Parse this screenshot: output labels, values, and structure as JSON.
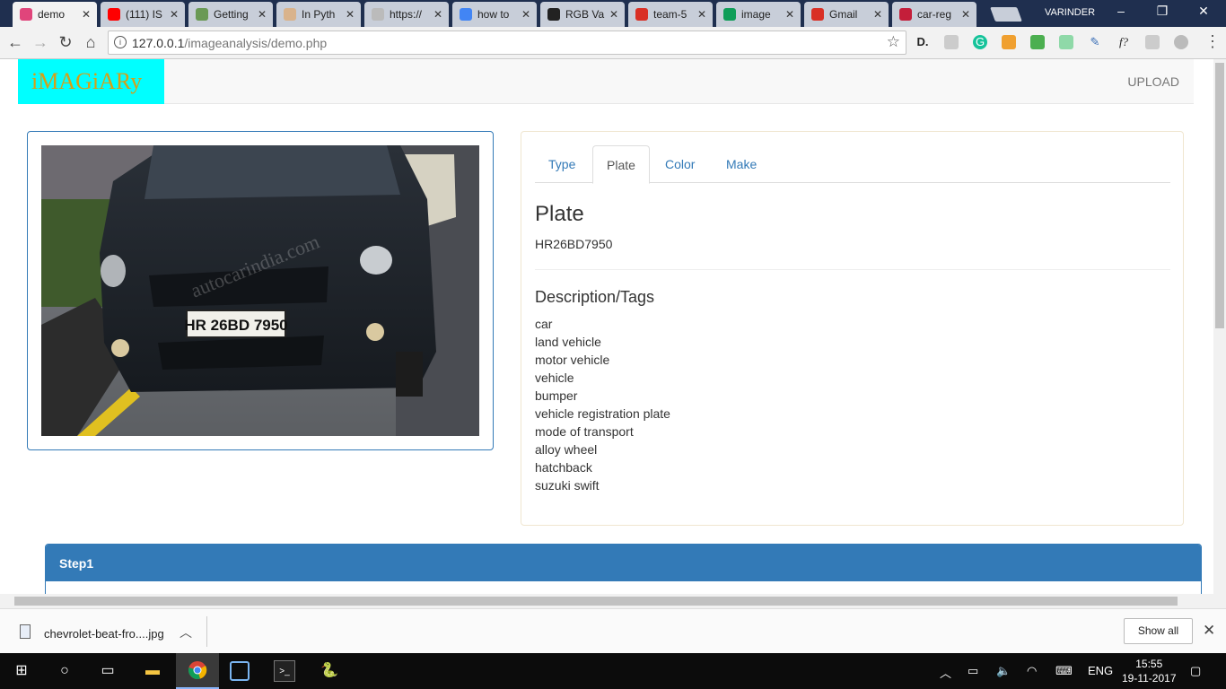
{
  "browser": {
    "tabs": [
      {
        "title": "demo",
        "color": "#e0457b",
        "active": true
      },
      {
        "title": "(111) IS",
        "color": "#ff0000"
      },
      {
        "title": "Getting",
        "color": "#6a9955"
      },
      {
        "title": "In Pyth",
        "color": "#d9b38c"
      },
      {
        "title": "https://",
        "color": "#bbbbbb"
      },
      {
        "title": "how to",
        "color": "#4285f4"
      },
      {
        "title": "RGB Va",
        "color": "#222222"
      },
      {
        "title": "team-5",
        "color": "#d93025"
      },
      {
        "title": "image",
        "color": "#0f9d58"
      },
      {
        "title": "Gmail",
        "color": "#d93025"
      },
      {
        "title": "car-reg",
        "color": "#c41e3a"
      }
    ],
    "user": "VARINDER",
    "url_host": "127.0.0.1",
    "url_path": "/imageanalysis/demo.php"
  },
  "page": {
    "brand": "iMAGiARy",
    "upload_label": "UPLOAD",
    "photo_watermark": "autocarindia.com",
    "photo_plate_text": "HR 26BD 7950",
    "result_tabs": [
      "Type",
      "Plate",
      "Color",
      "Make"
    ],
    "active_tab": "Plate",
    "plate_heading": "Plate",
    "plate_value": "HR26BD7950",
    "description_heading": "Description/Tags",
    "tags": [
      "car",
      "land vehicle",
      "motor vehicle",
      "vehicle",
      "bumper",
      "vehicle registration plate",
      "mode of transport",
      "alloy wheel",
      "hatchback",
      "suzuki swift"
    ],
    "step_title": "Step1"
  },
  "downloads": {
    "file_name": "chevrolet-beat-fro....jpg",
    "show_all_label": "Show all"
  },
  "taskbar": {
    "language": "ENG",
    "time": "15:55",
    "date": "19-11-2017"
  }
}
